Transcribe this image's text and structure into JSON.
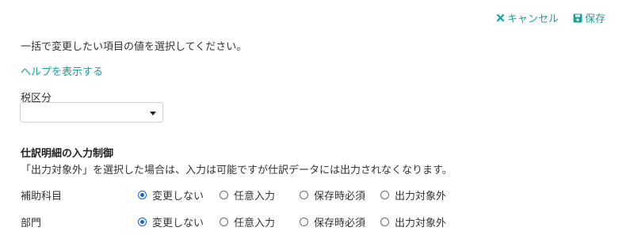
{
  "toolbar": {
    "cancel_label": "キャンセル",
    "save_label": "保存",
    "accent_color": "#1a9f9a"
  },
  "intro_text": "一括で変更したい項目の値を選択してください。",
  "help_link": "ヘルプを表示する",
  "tax": {
    "label": "税区分",
    "selected_value": ""
  },
  "journal_control": {
    "title": "仕訳明細の入力制御",
    "description": "「出力対象外」を選択した場合は、入力は可能ですが仕訳データには出力されなくなります。",
    "options": [
      "変更しない",
      "任意入力",
      "保存時必須",
      "出力対象外"
    ],
    "rows": [
      {
        "label": "補助科目",
        "selected": "変更しない"
      },
      {
        "label": "部門",
        "selected": "変更しない"
      }
    ]
  }
}
